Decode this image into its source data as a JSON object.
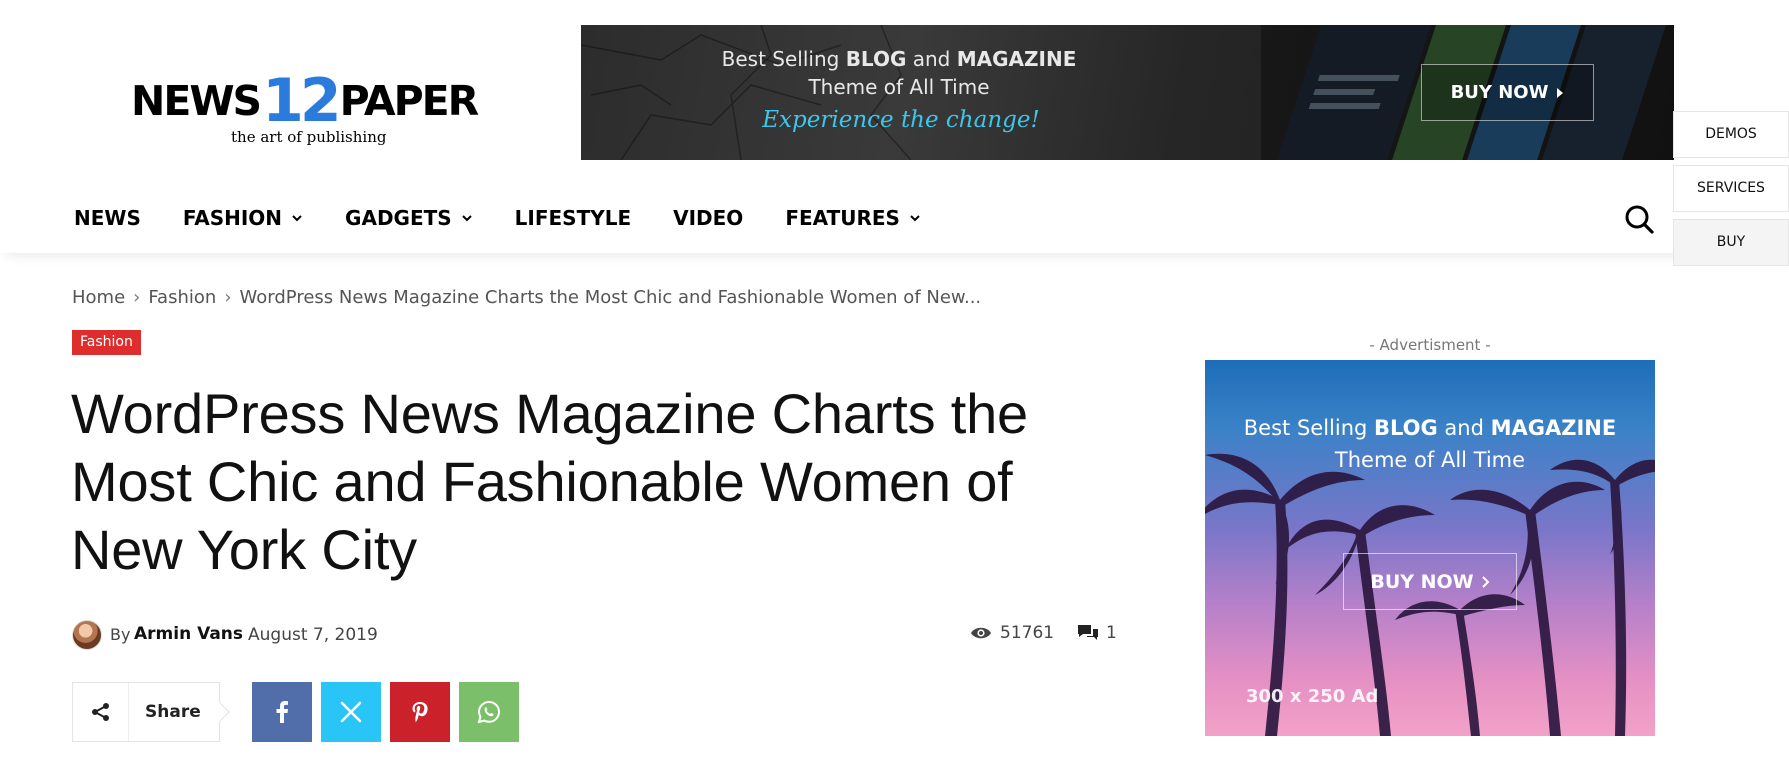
{
  "logo": {
    "part1": "NEWS",
    "number": "12",
    "part2": "PAPER",
    "tagline": "the art of publishing"
  },
  "top_banner": {
    "line1_pre": "Best Selling ",
    "line1_b1": "BLOG",
    "line1_mid": " and ",
    "line1_b2": "MAGAZINE",
    "line2": "Theme of All Time",
    "line3": "Experience the change!",
    "button": "BUY NOW"
  },
  "side_tabs": [
    "DEMOS",
    "SERVICES",
    "BUY"
  ],
  "nav": {
    "items": [
      {
        "label": "NEWS",
        "dropdown": false
      },
      {
        "label": "FASHION",
        "dropdown": true
      },
      {
        "label": "GADGETS",
        "dropdown": true
      },
      {
        "label": "LIFESTYLE",
        "dropdown": false
      },
      {
        "label": "VIDEO",
        "dropdown": false
      },
      {
        "label": "FEATURES",
        "dropdown": true
      }
    ],
    "search_icon": "search-icon"
  },
  "breadcrumb": {
    "home": "Home",
    "category": "Fashion",
    "current": "WordPress News Magazine Charts the Most Chic and Fashionable Women of New..."
  },
  "article": {
    "category": "Fashion",
    "category_color": "#dd2d2d",
    "title": "WordPress News Magazine Charts the Most Chic and Fashionable Women of New York City",
    "by": "By",
    "author": "Armin Vans",
    "date": "August 7, 2019",
    "views": "51761",
    "comments": "1"
  },
  "share": {
    "label": "Share",
    "colors": {
      "facebook": "#516eab",
      "twitter": "#29c5f6",
      "pinterest": "#ca212a",
      "whatsapp": "#7bbf6a"
    }
  },
  "sidebar_ad": {
    "label": "- Advertisment -",
    "line1_pre": "Best Selling ",
    "line1_b1": "BLOG",
    "line1_mid": " and ",
    "line1_b2": "MAGAZINE",
    "line2": "Theme of All Time",
    "button": "BUY NOW",
    "size": "300 x 250 Ad"
  }
}
